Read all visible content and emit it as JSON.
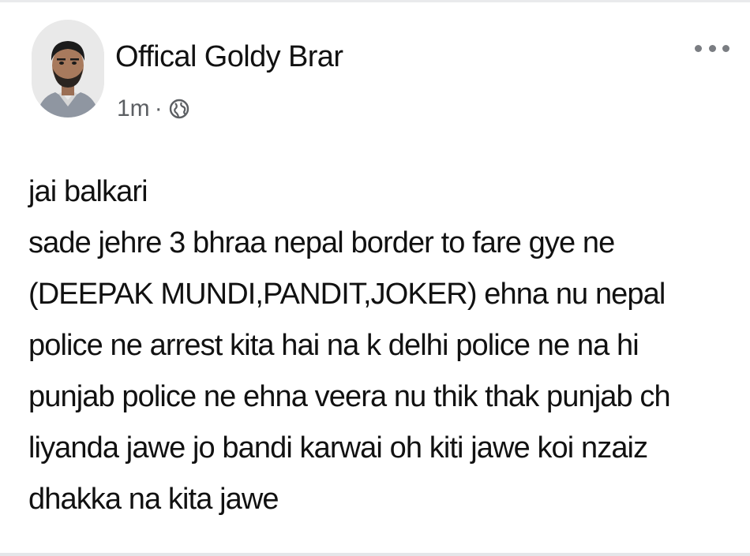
{
  "post": {
    "author_name": "Offical Goldy Brar",
    "timestamp": "1m",
    "separator": "·",
    "privacy_icon": "globe-icon",
    "more_icon": "more-options-icon",
    "lines": [
      "jai balkari",
      "sade jehre 3 bhraa nepal border to fare gye ne",
      "(DEEPAK MUNDI,PANDIT,JOKER) ehna nu nepal",
      "police ne arrest kita hai na k delhi police ne na hi",
      "punjab police ne ehna veera nu thik thak punjab ch",
      "liyanda jawe jo bandi karwai oh kiti jawe koi nzaiz",
      "dhakka na kita jawe"
    ]
  },
  "colors": {
    "text_primary": "#111111",
    "text_secondary": "#5c5f63",
    "background": "#ffffff",
    "divider": "#e4e6e9"
  }
}
